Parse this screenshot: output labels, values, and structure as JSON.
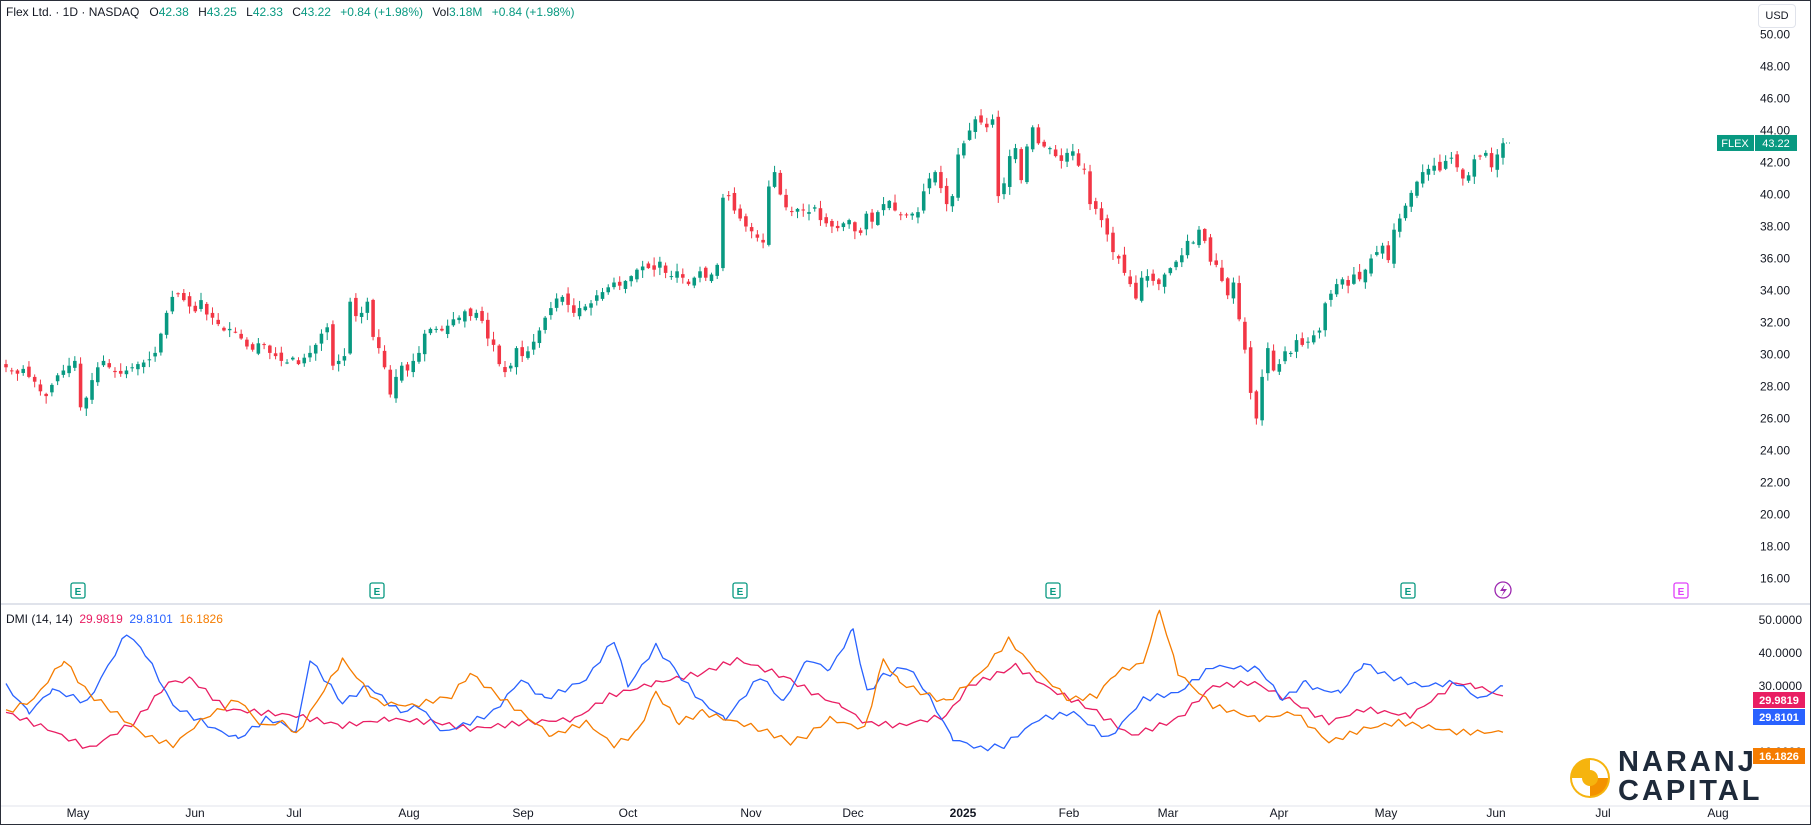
{
  "header": {
    "symbol": "Flex Ltd. · 1D · NASDAQ",
    "o_label": "O",
    "o_value": "42.38",
    "h_label": "H",
    "h_value": "43.25",
    "l_label": "L",
    "l_value": "42.33",
    "c_label": "C",
    "c_value": "43.22",
    "change": "+0.84 (+1.98%)",
    "vol_label": "Vol",
    "vol_value": "3.18M",
    "vol_change": "+0.84 (+1.98%)"
  },
  "currency": "USD",
  "price_tag": {
    "ticker": "FLEX",
    "value": "43.22"
  },
  "dmi_header": {
    "label": "DMI (14, 14)",
    "adx": "29.9819",
    "plus_di": "29.8101",
    "minus_di": "16.1826"
  },
  "dmi_tags": {
    "adx": "29.9819",
    "plus_di": "29.8101",
    "minus_di": "16.1826"
  },
  "logo": {
    "line1": "NARANJ",
    "line2": "CAPITAL"
  },
  "colors": {
    "up": "#089981",
    "down": "#f23645",
    "adx": "#e91e63",
    "plus_di": "#2962ff",
    "minus_di": "#f57c00",
    "earnings": "#089981",
    "earnings_future": "#e040fb",
    "dividend": "#9c27b0"
  },
  "chart_data": [
    {
      "type": "candlestick",
      "title": "Flex Ltd. · 1D · NASDAQ",
      "ylim": [
        16,
        50
      ],
      "y_ticks": [
        "16.00",
        "18.00",
        "20.00",
        "22.00",
        "24.00",
        "26.00",
        "28.00",
        "30.00",
        "32.00",
        "34.00",
        "36.00",
        "38.00",
        "40.00",
        "42.00",
        "44.00",
        "46.00",
        "48.00",
        "50.00"
      ],
      "x_ticks": [
        "May",
        "Jun",
        "Jul",
        "Aug",
        "Sep",
        "Oct",
        "Nov",
        "Dec",
        "2025",
        "Feb",
        "Mar",
        "Apr",
        "May",
        "Jun",
        "Jul",
        "Aug"
      ],
      "x_range": [
        "2024-04-16",
        "2025-08-31"
      ],
      "closes": [
        29.2,
        29.0,
        28.8,
        29.1,
        28.6,
        28.3,
        27.7,
        27.4,
        28.1,
        28.7,
        29.0,
        29.3,
        29.6,
        26.7,
        27.3,
        28.4,
        29.2,
        29.6,
        29.2,
        28.9,
        28.8,
        29.0,
        29.2,
        29.4,
        29.5,
        29.7,
        30.1,
        31.3,
        32.6,
        33.6,
        33.8,
        33.4,
        33.0,
        32.7,
        33.4,
        32.5,
        32.3,
        31.9,
        31.5,
        31.6,
        31.4,
        31.0,
        30.5,
        30.3,
        30.7,
        30.6,
        30.1,
        29.9,
        29.6,
        29.5,
        29.8,
        29.4,
        29.8,
        30.1,
        30.6,
        31.3,
        31.7,
        29.3,
        29.6,
        29.9,
        33.3,
        32.4,
        32.6,
        33.3,
        31.1,
        30.4,
        29.2,
        27.5,
        28.6,
        29.3,
        29.0,
        29.6,
        30.1,
        31.3,
        31.6,
        31.6,
        31.5,
        31.8,
        32.2,
        32.3,
        32.7,
        32.4,
        32.6,
        32.1,
        31.0,
        30.6,
        29.4,
        28.9,
        29.3,
        30.4,
        29.9,
        30.2,
        30.8,
        31.5,
        32.3,
        32.9,
        33.5,
        33.6,
        33.1,
        32.6,
        32.9,
        33.0,
        33.2,
        33.7,
        33.9,
        34.2,
        34.5,
        34.3,
        34.6,
        34.9,
        35.3,
        35.5,
        35.4,
        35.3,
        35.8,
        35.1,
        34.9,
        35.2,
        34.8,
        34.4,
        34.8,
        35.2,
        34.8,
        35.0,
        35.6,
        39.8,
        39.9,
        39.0,
        38.5,
        38.0,
        37.7,
        37.3,
        37.0,
        40.5,
        41.4,
        40.0,
        39.2,
        38.9,
        39.1,
        39.0,
        38.9,
        39.2,
        38.4,
        38.2,
        38.0,
        37.9,
        38.2,
        38.4,
        37.7,
        37.6,
        38.8,
        38.3,
        38.9,
        39.4,
        39.6,
        39.0,
        38.7,
        38.7,
        38.8,
        38.9,
        40.2,
        41.0,
        41.4,
        40.4,
        39.4,
        39.9,
        42.5,
        43.2,
        44.0,
        44.7,
        44.5,
        44.2,
        44.7,
        39.9,
        40.7,
        42.4,
        42.9,
        40.9,
        43.0,
        44.2,
        43.2,
        43.0,
        42.9,
        42.4,
        42.1,
        42.6,
        42.7,
        41.8,
        41.6,
        39.4,
        39.1,
        38.4,
        37.5,
        36.4,
        36.0,
        35.1,
        34.4,
        33.5,
        34.8,
        34.9,
        34.6,
        34.4,
        35.0,
        35.4,
        35.8,
        36.2,
        37.1,
        37.0,
        37.8,
        37.1,
        35.8,
        35.6,
        34.6,
        33.7,
        34.5,
        32.2,
        30.3,
        27.6,
        26.0,
        28.6,
        30.4,
        29.0,
        29.4,
        30.2,
        30.1,
        30.9,
        30.6,
        30.8,
        31.2,
        31.5,
        33.2,
        33.8,
        34.4,
        34.7,
        34.3,
        35.0,
        34.7,
        35.3,
        36.0,
        36.4,
        36.8,
        35.9,
        37.8,
        38.5,
        39.3,
        40.1,
        40.8,
        41.4,
        41.6,
        41.8,
        41.5,
        42.1,
        42.3,
        41.7,
        41.0,
        41.2,
        42.2,
        42.4,
        42.6,
        41.7,
        42.5,
        43.2
      ],
      "candle_count": 283,
      "last_close": 43.22
    },
    {
      "type": "line",
      "title": "DMI (14, 14)",
      "ylim": [
        3,
        53
      ],
      "y_ticks": [
        "10.0000",
        "20.0000",
        "30.0000",
        "40.0000",
        "50.0000"
      ],
      "series": [
        {
          "name": "ADX",
          "color": "#e91e63",
          "last": 29.9819,
          "keys": [
            [
              0,
              22
            ],
            [
              18,
              17
            ],
            [
              36,
              11
            ],
            [
              55,
              19
            ],
            [
              70,
              31
            ],
            [
              80,
              32
            ],
            [
              95,
              23
            ],
            [
              125,
              21
            ],
            [
              145,
              18
            ],
            [
              165,
              20
            ],
            [
              185,
              19
            ],
            [
              200,
              17
            ],
            [
              225,
              19
            ],
            [
              245,
              20
            ],
            [
              260,
              27
            ],
            [
              280,
              31
            ],
            [
              300,
              34
            ],
            [
              315,
              38
            ],
            [
              335,
              33
            ],
            [
              350,
              27
            ],
            [
              360,
              24
            ],
            [
              370,
              19
            ],
            [
              385,
              18
            ],
            [
              405,
              21
            ],
            [
              415,
              30
            ],
            [
              435,
              36
            ],
            [
              450,
              29
            ],
            [
              462,
              25
            ],
            [
              470,
              22
            ],
            [
              485,
              15
            ],
            [
              505,
              20
            ],
            [
              520,
              30
            ],
            [
              538,
              31
            ],
            [
              555,
              25
            ],
            [
              570,
              19
            ],
            [
              585,
              23
            ],
            [
              605,
              21
            ],
            [
              625,
              31
            ],
            [
              633,
              30
            ],
            [
              645,
              27
            ]
          ]
        },
        {
          "name": "+DI",
          "color": "#2962ff",
          "last": 29.8101,
          "keys": [
            [
              0,
              30
            ],
            [
              10,
              22
            ],
            [
              20,
              29
            ],
            [
              35,
              25
            ],
            [
              52,
              46
            ],
            [
              60,
              40
            ],
            [
              72,
              24
            ],
            [
              90,
              17
            ],
            [
              100,
              14
            ],
            [
              112,
              20
            ],
            [
              118,
              19
            ],
            [
              125,
              16
            ],
            [
              131,
              38
            ],
            [
              145,
              25
            ],
            [
              156,
              30
            ],
            [
              170,
              22
            ],
            [
              178,
              24
            ],
            [
              188,
              16
            ],
            [
              200,
              19
            ],
            [
              210,
              22
            ],
            [
              222,
              32
            ],
            [
              232,
              26
            ],
            [
              250,
              32
            ],
            [
              262,
              44
            ],
            [
              268,
              30
            ],
            [
              280,
              42
            ],
            [
              288,
              35
            ],
            [
              300,
              25
            ],
            [
              310,
              20
            ],
            [
              325,
              33
            ],
            [
              335,
              25
            ],
            [
              345,
              38
            ],
            [
              355,
              35
            ],
            [
              365,
              47
            ],
            [
              371,
              28
            ],
            [
              378,
              33
            ],
            [
              388,
              36
            ],
            [
              395,
              30
            ],
            [
              408,
              14
            ],
            [
              420,
              11
            ],
            [
              430,
              12
            ],
            [
              445,
              20
            ],
            [
              460,
              22
            ],
            [
              475,
              14
            ],
            [
              490,
              26
            ],
            [
              505,
              28
            ],
            [
              520,
              36
            ],
            [
              540,
              35
            ],
            [
              550,
              26
            ],
            [
              560,
              31
            ],
            [
              565,
              29
            ],
            [
              575,
              28
            ],
            [
              585,
              37
            ],
            [
              595,
              33
            ],
            [
              610,
              30
            ],
            [
              625,
              31
            ],
            [
              635,
              26
            ],
            [
              645,
              30
            ]
          ]
        },
        {
          "name": "−DI",
          "color": "#f57c00",
          "last": 16.1826,
          "keys": [
            [
              0,
              22
            ],
            [
              12,
              26
            ],
            [
              25,
              38
            ],
            [
              35,
              28
            ],
            [
              45,
              23
            ],
            [
              60,
              15
            ],
            [
              72,
              12
            ],
            [
              85,
              20
            ],
            [
              100,
              26
            ],
            [
              110,
              18
            ],
            [
              120,
              19
            ],
            [
              125,
              15
            ],
            [
              145,
              38
            ],
            [
              160,
              25
            ],
            [
              175,
              24
            ],
            [
              192,
              27
            ],
            [
              200,
              34
            ],
            [
              210,
              28
            ],
            [
              222,
              22
            ],
            [
              235,
              15
            ],
            [
              250,
              19
            ],
            [
              262,
              12
            ],
            [
              272,
              16
            ],
            [
              280,
              28
            ],
            [
              290,
              19
            ],
            [
              300,
              22
            ],
            [
              315,
              19
            ],
            [
              325,
              17
            ],
            [
              338,
              13
            ],
            [
              345,
              15
            ],
            [
              355,
              20
            ],
            [
              370,
              17
            ],
            [
              378,
              38
            ],
            [
              385,
              31
            ],
            [
              395,
              28
            ],
            [
              405,
              25
            ],
            [
              420,
              34
            ],
            [
              432,
              44
            ],
            [
              445,
              34
            ],
            [
              458,
              26
            ],
            [
              470,
              27
            ],
            [
              478,
              34
            ],
            [
              490,
              37
            ],
            [
              497,
              53
            ],
            [
              505,
              34
            ],
            [
              520,
              24
            ],
            [
              540,
              20
            ],
            [
              555,
              22
            ],
            [
              570,
              13
            ],
            [
              585,
              17
            ],
            [
              600,
              19
            ],
            [
              610,
              18
            ],
            [
              625,
              16
            ],
            [
              645,
              16
            ]
          ]
        }
      ]
    }
  ]
}
